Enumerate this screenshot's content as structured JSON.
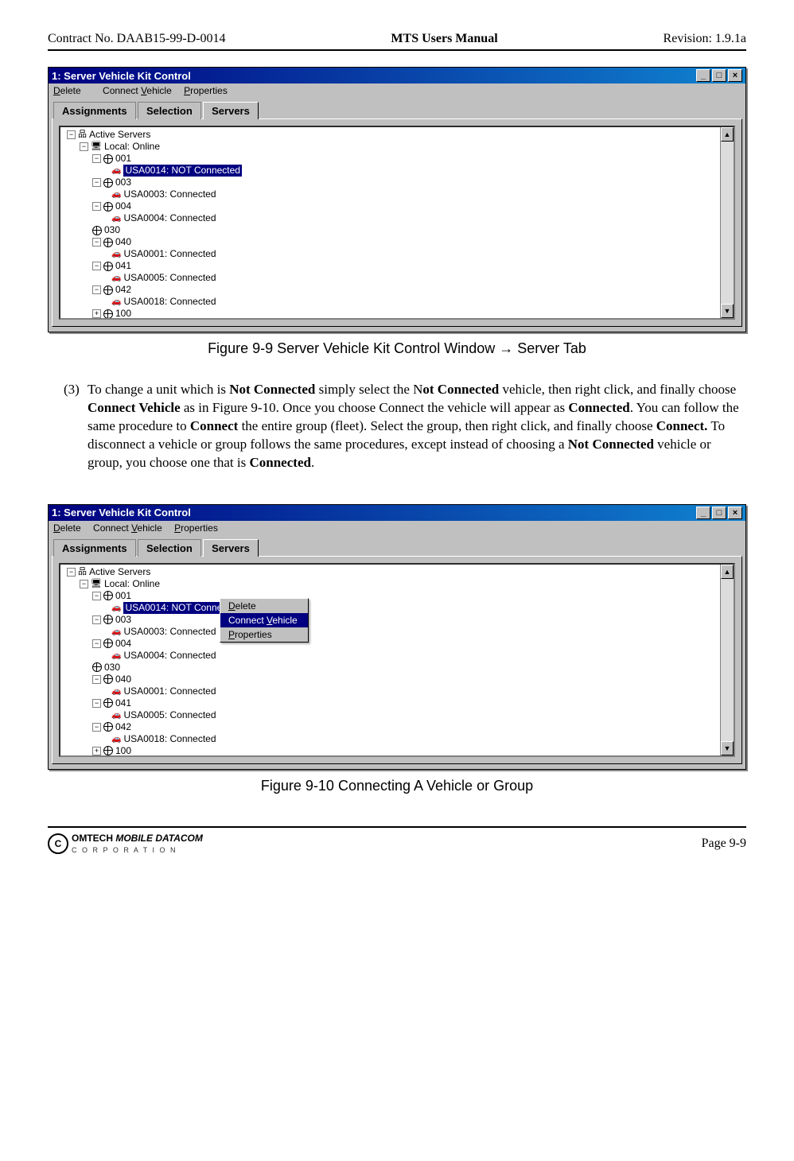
{
  "header": {
    "left": "Contract No. DAAB15-99-D-0014",
    "center": "MTS Users Manual",
    "right": "Revision:  1.9.1a"
  },
  "footer": {
    "logo_brand": "OMTECH",
    "logo_main": "MOBILE DATACOM",
    "logo_sub": "C O R P O R A T I O N",
    "page": "Page 9-9"
  },
  "window": {
    "title": "1: Server Vehicle Kit Control",
    "menu": {
      "delete": "Delete",
      "connect": "Connect Vehicle",
      "properties": "Properties"
    },
    "tabs": {
      "assignments": "Assignments",
      "selection": "Selection",
      "servers": "Servers"
    },
    "tree": {
      "root": "Active Servers",
      "local": "Local: Online",
      "g001": "001",
      "v001": "USA0014: NOT Connected",
      "g003": "003",
      "v003": "USA0003: Connected",
      "g004": "004",
      "v004": "USA0004: Connected",
      "g030": "030",
      "g040": "040",
      "v040": "USA0001: Connected",
      "g041": "041",
      "v041": "USA0005: Connected",
      "g042": "042",
      "v042": "USA0018: Connected",
      "g100": "100"
    },
    "context": {
      "delete": "Delete",
      "connect": "Connect Vehicle",
      "properties": "Properties"
    }
  },
  "caption1": "Figure 9-9     Server Vehicle Kit Control Window → Server Tab",
  "caption2": "Figure 9-10   Connecting A Vehicle or Group",
  "body": {
    "num": "(3)",
    "p1a": "To change a unit which is ",
    "p1b": "Not Connected",
    "p1c": " simply select the N",
    "p1d": "ot Connected",
    "p1e": " vehicle, then right click, and finally choose ",
    "p1f": "Connect Vehicle",
    "p1g": " as in Figure 9-10. Once you choose Connect the vehicle will appear as ",
    "p1h": "Connected",
    "p1i": ".  You can follow the same procedure to ",
    "p1j": "Connect",
    "p1k": " the entire group (fleet). Select the group, then right click, and finally choose ",
    "p1l": "Connect.",
    "p1m": "  To disconnect a vehicle or group follows the same procedures, except instead of choosing a ",
    "p1n": "Not Connected",
    "p1o": " vehicle or group, you choose one that is ",
    "p1p": "Connected",
    "p1q": "."
  }
}
